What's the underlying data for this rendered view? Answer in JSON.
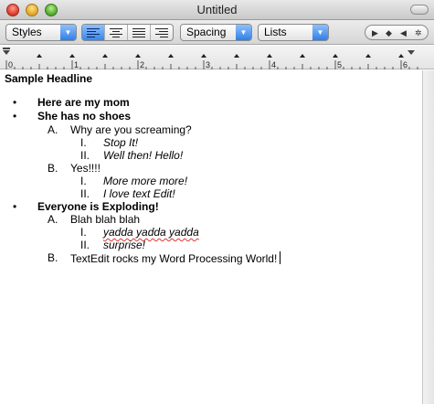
{
  "window": {
    "title": "Untitled"
  },
  "toolbar": {
    "styles_label": "Styles",
    "spacing_label": "Spacing",
    "lists_label": "Lists",
    "alignment_selected": "left"
  },
  "ruler": {
    "numbers": [
      "0",
      "1",
      "2",
      "3",
      "4",
      "5",
      "6"
    ]
  },
  "document": {
    "headline": "Sample Headline",
    "bullet_glyph": "•",
    "items": [
      {
        "marker": "•",
        "text": "Here are my mom"
      },
      {
        "marker": "•",
        "text": "She has no shoes"
      },
      {
        "marker": "A.",
        "text": "Why are you screaming?"
      },
      {
        "marker": "I.",
        "text": "Stop It!"
      },
      {
        "marker": "II.",
        "text": "Well then!  Hello!"
      },
      {
        "marker": "B.",
        "text": "Yes!!!!"
      },
      {
        "marker": "I.",
        "text": "More more more!"
      },
      {
        "marker": "II.",
        "text": "I love text Edit!"
      },
      {
        "marker": "•",
        "text": "Everyone is Exploding!"
      },
      {
        "marker": "A.",
        "text": "Blah blah blah"
      },
      {
        "marker": "I.",
        "text": "yadda yadda yadda"
      },
      {
        "marker": "II.",
        "text": "surprise!"
      },
      {
        "marker": "B.",
        "text": "TextEdit rocks my Word Processing World!"
      }
    ]
  },
  "colors": {
    "accent": "#3a86ea",
    "spell_underline": "#e23232"
  }
}
